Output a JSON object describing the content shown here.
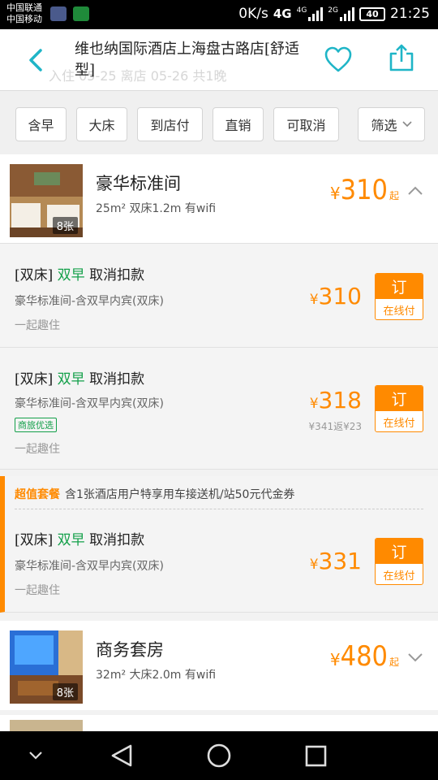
{
  "status_bar": {
    "carrier_1": "中国联通",
    "carrier_2": "中国移动",
    "speed": "0K/s",
    "net_4g": "4G",
    "net_4g_small": "4G",
    "net_2g": "2G",
    "battery": "40",
    "time": "21:25"
  },
  "header": {
    "title": "维也纳国际酒店上海盘古路店[舒适型]",
    "ghost_text": "入住 05-25  离店 05-26  共1晚",
    "back_icon": "back-chevron-icon",
    "favorite_icon": "heart-outline-icon",
    "share_icon": "share-icon"
  },
  "filters": {
    "items": [
      "含早",
      "大床",
      "到店付",
      "直销",
      "可取消"
    ],
    "more_label": "筛选"
  },
  "rooms": [
    {
      "name": "豪华标准间",
      "desc": "25m² 双床1.2m 有wifi",
      "price_currency": "¥",
      "price": "310",
      "price_suffix": "起",
      "photo_count": "8张",
      "expanded": true
    },
    {
      "name": "商务套房",
      "desc": "32m² 大床2.0m 有wifi",
      "price_currency": "¥",
      "price": "480",
      "price_suffix": "起",
      "photo_count": "8张",
      "expanded": false
    }
  ],
  "rates": [
    {
      "bed": "[双床]",
      "breakfast": "双早",
      "policy": "取消扣款",
      "sub": "豪华标准间-含双早内宾(双床)",
      "note": "一起趣住",
      "price": "310",
      "book_label": "订",
      "pay_label": "在线付"
    },
    {
      "bed": "[双床]",
      "breakfast": "双早",
      "policy": "取消扣款",
      "sub": "豪华标准间-含双早内宾(双床)",
      "tag": "商旅优选",
      "note": "一起趣住",
      "price": "318",
      "original": "¥341返¥23",
      "book_label": "订",
      "pay_label": "在线付"
    },
    {
      "bed": "[双床]",
      "breakfast": "双早",
      "policy": "取消扣款",
      "sub": "豪华标准间-含双早内宾(双床)",
      "note": "一起趣住",
      "price": "331",
      "book_label": "订",
      "pay_label": "在线付"
    }
  ],
  "package": {
    "highlight": "超值套餐",
    "text": "含1张酒店用户特享用车接送机/站50元代金券"
  },
  "currency": "¥",
  "colors": {
    "accent": "#ff8a00",
    "teal": "#1fb5c7",
    "green": "#14a04a"
  }
}
